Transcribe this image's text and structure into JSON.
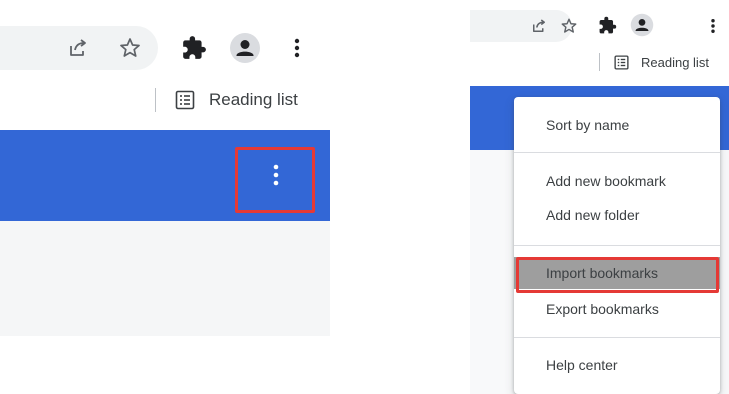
{
  "left": {
    "bookmarks_bar": {
      "reading_list_label": "Reading list"
    },
    "toolbar": {
      "icons": [
        "share-icon",
        "star-icon",
        "extensions-icon",
        "profile-icon",
        "more-vert-icon"
      ]
    }
  },
  "right": {
    "bookmarks_bar": {
      "reading_list_label": "Reading list"
    },
    "menu": {
      "items": [
        {
          "label": "Sort by name"
        },
        {
          "label": "Add new bookmark"
        },
        {
          "label": "Add new folder"
        },
        {
          "label": "Import bookmarks",
          "highlighted": true
        },
        {
          "label": "Export bookmarks"
        },
        {
          "label": "Help center"
        }
      ]
    }
  },
  "colors": {
    "header_blue": "#3367d6",
    "highlight_red": "#e53935",
    "menu_highlight_gray": "#9e9e9e"
  }
}
